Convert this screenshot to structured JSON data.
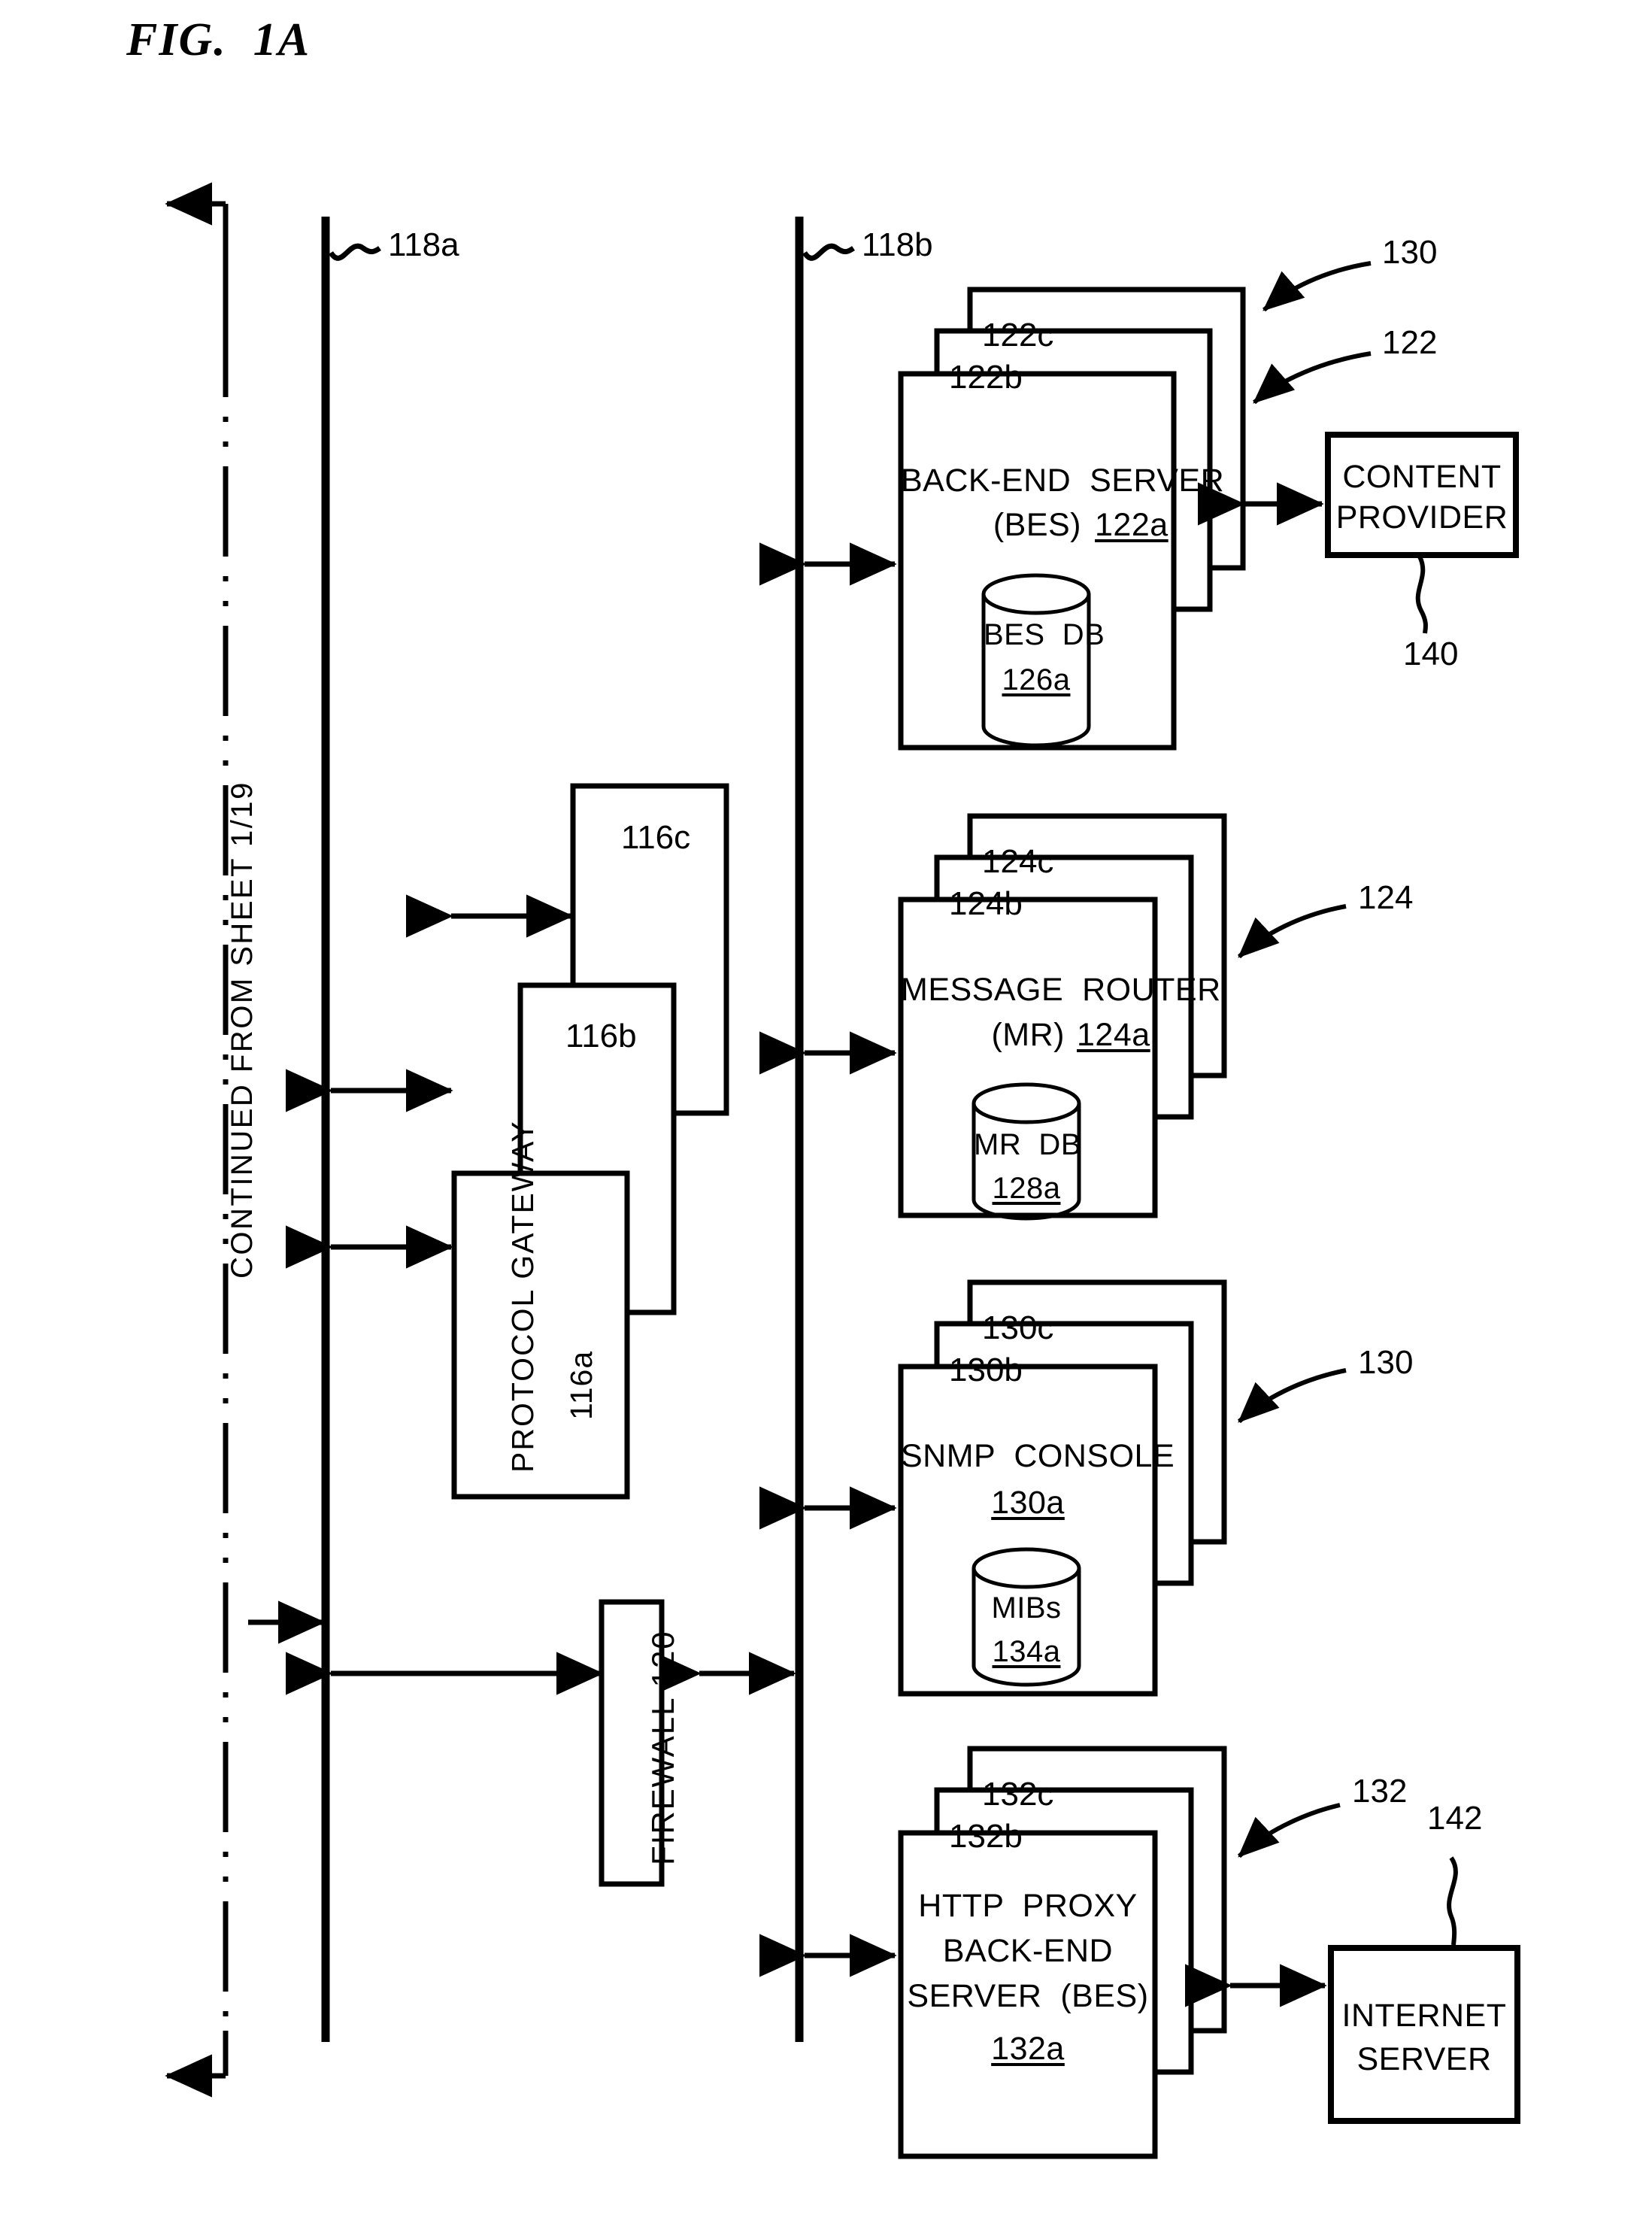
{
  "figure": {
    "title": "FIG.  1A",
    "continued_note": "CONTINUED  FROM  SHEET 1/19"
  },
  "reference_lines": {
    "left_line_label": "118a",
    "right_line_label": "118b"
  },
  "firewall": {
    "label": "FIREWALL 120"
  },
  "protocol_gateway": {
    "front_label": "PROTOCOL GATEWAY",
    "front_ref": "116a",
    "middle_ref": "116b",
    "back_ref": "116c"
  },
  "back_end_server": {
    "title_line1": "BACK-END  SERVER",
    "title_line2": "(BES)",
    "front_ref": "122a",
    "middle_ref": "122b",
    "back_ref": "122c",
    "db_name": "BES  DB",
    "db_ref": "126a",
    "callout_top": "130",
    "callout_stack": "122"
  },
  "message_router": {
    "title_line1": "MESSAGE  ROUTER",
    "title_line2": "(MR)",
    "front_ref": "124a",
    "middle_ref": "124b",
    "back_ref": "124c",
    "db_name": "MR  DB",
    "db_ref": "128a",
    "callout_stack": "124"
  },
  "snmp_console": {
    "title_line1": "SNMP  CONSOLE",
    "front_ref": "130a",
    "middle_ref": "130b",
    "back_ref": "130c",
    "db_name": "MIBs",
    "db_ref": "134a",
    "callout_stack": "130"
  },
  "http_proxy_bes": {
    "title_line1": "HTTP  PROXY",
    "title_line2": "BACK-END",
    "title_line3": "SERVER  (BES)",
    "front_ref": "132a",
    "middle_ref": "132b",
    "back_ref": "132c",
    "callout_stack": "132",
    "callout_internet_server": "142"
  },
  "content_provider": {
    "line1": "CONTENT",
    "line2": "PROVIDER",
    "ref": "140"
  },
  "internet_server": {
    "line1": "INTERNET",
    "line2": "SERVER"
  },
  "colors": {
    "ink": "#000000",
    "paper": "#ffffff"
  }
}
